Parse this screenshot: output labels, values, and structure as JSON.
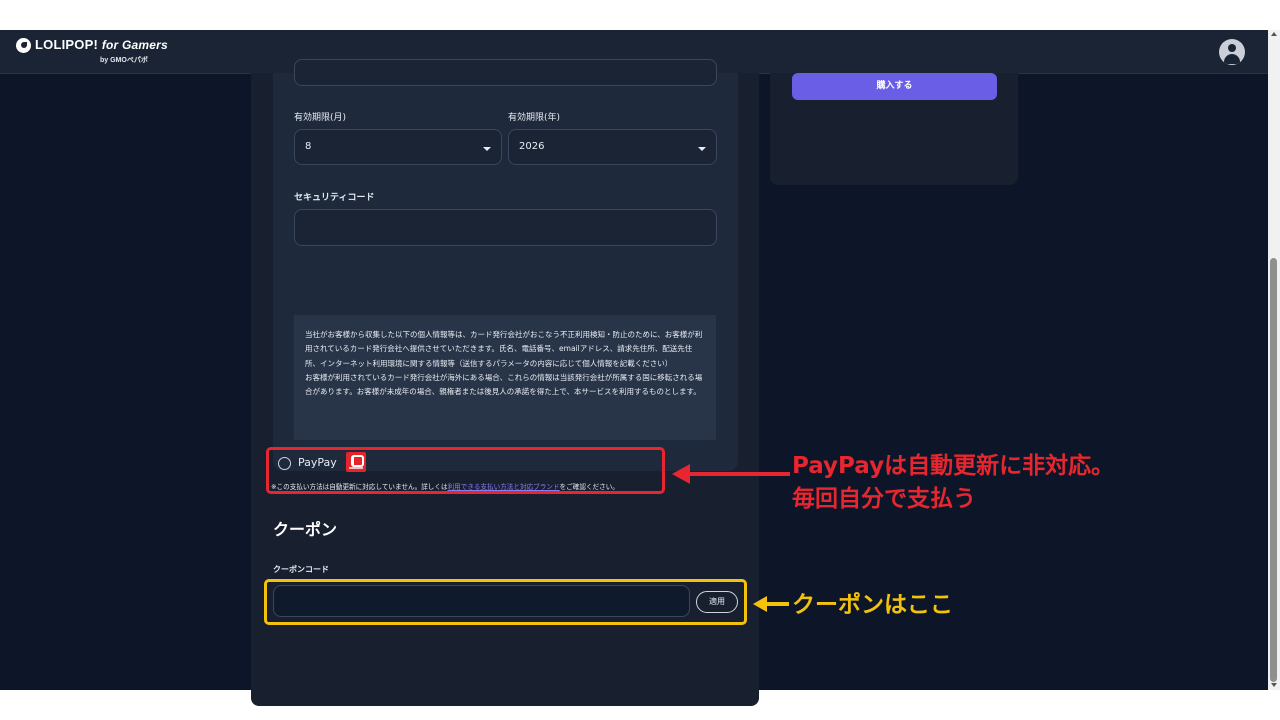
{
  "header": {
    "logo_brand": "LOLIPOP!",
    "logo_for": "for Gamers",
    "logo_sub": "by GMOペパボ"
  },
  "summary": {
    "buy_label": "購入する"
  },
  "card_form": {
    "month_label": "有効期限(月)",
    "month_value": "8",
    "year_label": "有効期限(年)",
    "year_value": "2026",
    "cvc_label": "セキュリティコード",
    "cvc_value": "",
    "notice_text": "当社がお客様から収集した以下の個人情報等は、カード発行会社がおこなう不正利用検知・防止のために、お客様が利用されているカード発行会社へ提供させていただきます。氏名、電話番号、emailアドレス、請求先住所、配送先住所、インターネット利用環境に関する情報等（送信するパラメータの内容に応じて個人情報を記載ください）\nお客様が利用されているカード発行会社が海外にある場合、これらの情報は当該発行会社が所属する国に移転される場合があります。お客様が未成年の場合、親権者または後見人の承諾を得た上で、本サービスを利用するものとします。"
  },
  "paypay": {
    "label": "PayPay",
    "note_prefix": "※この支払い方法は自動更新に対応していません。詳しくは",
    "note_link": "利用できる支払い方法と対応ブランド",
    "note_suffix": "をご確認ください。"
  },
  "coupon": {
    "title": "クーポン",
    "code_label": "クーポンコード",
    "code_value": "",
    "apply_label": "適用"
  },
  "annotations": {
    "red_line1": "PayPayは自動更新に非対応。",
    "red_line2": "毎回自分で支払う",
    "yellow": "クーポンはここ",
    "red_color": "#e8262f",
    "yellow_color": "#f4c20d"
  },
  "icons": {
    "avatar": "user-avatar-icon",
    "select_caret": "chevron-down-icon",
    "radio": "radio-unchecked-icon",
    "paypay_logo": "paypay-logo-icon"
  },
  "colors": {
    "page_bg": "#0c1628",
    "panel": "#18202f",
    "accent": "#6b5ee6"
  }
}
